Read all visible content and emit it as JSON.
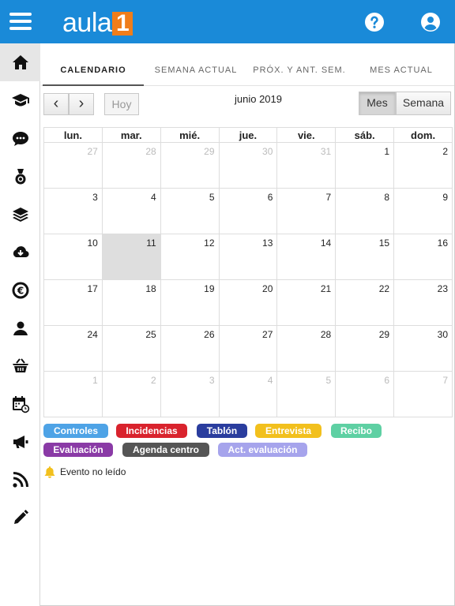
{
  "header": {
    "logo_text": "aula",
    "logo_number": "1",
    "help_icon": "help-icon",
    "user_icon": "user-icon"
  },
  "sidebar": {
    "items": [
      {
        "icon": "home-icon"
      },
      {
        "icon": "graduation-cap-icon"
      },
      {
        "icon": "chat-icon"
      },
      {
        "icon": "medal-icon"
      },
      {
        "icon": "layers-icon"
      },
      {
        "icon": "cloud-download-icon"
      },
      {
        "icon": "euro-icon"
      },
      {
        "icon": "user-icon"
      },
      {
        "icon": "basket-icon"
      },
      {
        "icon": "calendar-clock-icon"
      },
      {
        "icon": "megaphone-icon"
      },
      {
        "icon": "rss-icon"
      },
      {
        "icon": "pencil-icon"
      }
    ]
  },
  "tabs": [
    "CALENDARIO",
    "SEMANA ACTUAL",
    "PRÓX. Y ANT. SEM.",
    "MES ACTUAL"
  ],
  "toolbar": {
    "prev_label": "‹",
    "next_label": "›",
    "today_label": "Hoy",
    "title": "junio 2019",
    "month_label": "Mes",
    "week_label": "Semana"
  },
  "calendar": {
    "weekdays": [
      "lun.",
      "mar.",
      "mié.",
      "jue.",
      "vie.",
      "sáb.",
      "dom."
    ],
    "weeks": [
      [
        "27",
        "28",
        "29",
        "30",
        "31",
        "1",
        "2"
      ],
      [
        "3",
        "4",
        "5",
        "6",
        "7",
        "8",
        "9"
      ],
      [
        "10",
        "11",
        "12",
        "13",
        "14",
        "15",
        "16"
      ],
      [
        "17",
        "18",
        "19",
        "20",
        "21",
        "22",
        "23"
      ],
      [
        "24",
        "25",
        "26",
        "27",
        "28",
        "29",
        "30"
      ],
      [
        "1",
        "2",
        "3",
        "4",
        "5",
        "6",
        "7"
      ]
    ]
  },
  "legend": {
    "tags": [
      {
        "label": "Controles",
        "color": "#4ea3e6"
      },
      {
        "label": "Incidencias",
        "color": "#d9232d"
      },
      {
        "label": "Tablón",
        "color": "#2a3d9e"
      },
      {
        "label": "Entrevista",
        "color": "#f2c01d"
      },
      {
        "label": "Recibo",
        "color": "#5ed0a3"
      },
      {
        "label": "Evaluación",
        "color": "#8a3aa6"
      },
      {
        "label": "Agenda centro",
        "color": "#555555"
      },
      {
        "label": "Act. evaluación",
        "color": "#a6a4ec"
      }
    ],
    "unread_label": "Evento no leído",
    "unread_icon": "bell-icon",
    "bell_color": "#f2c01d"
  },
  "colors": {
    "header": "#1a8ad8",
    "logo_accent": "#f07d1a"
  }
}
